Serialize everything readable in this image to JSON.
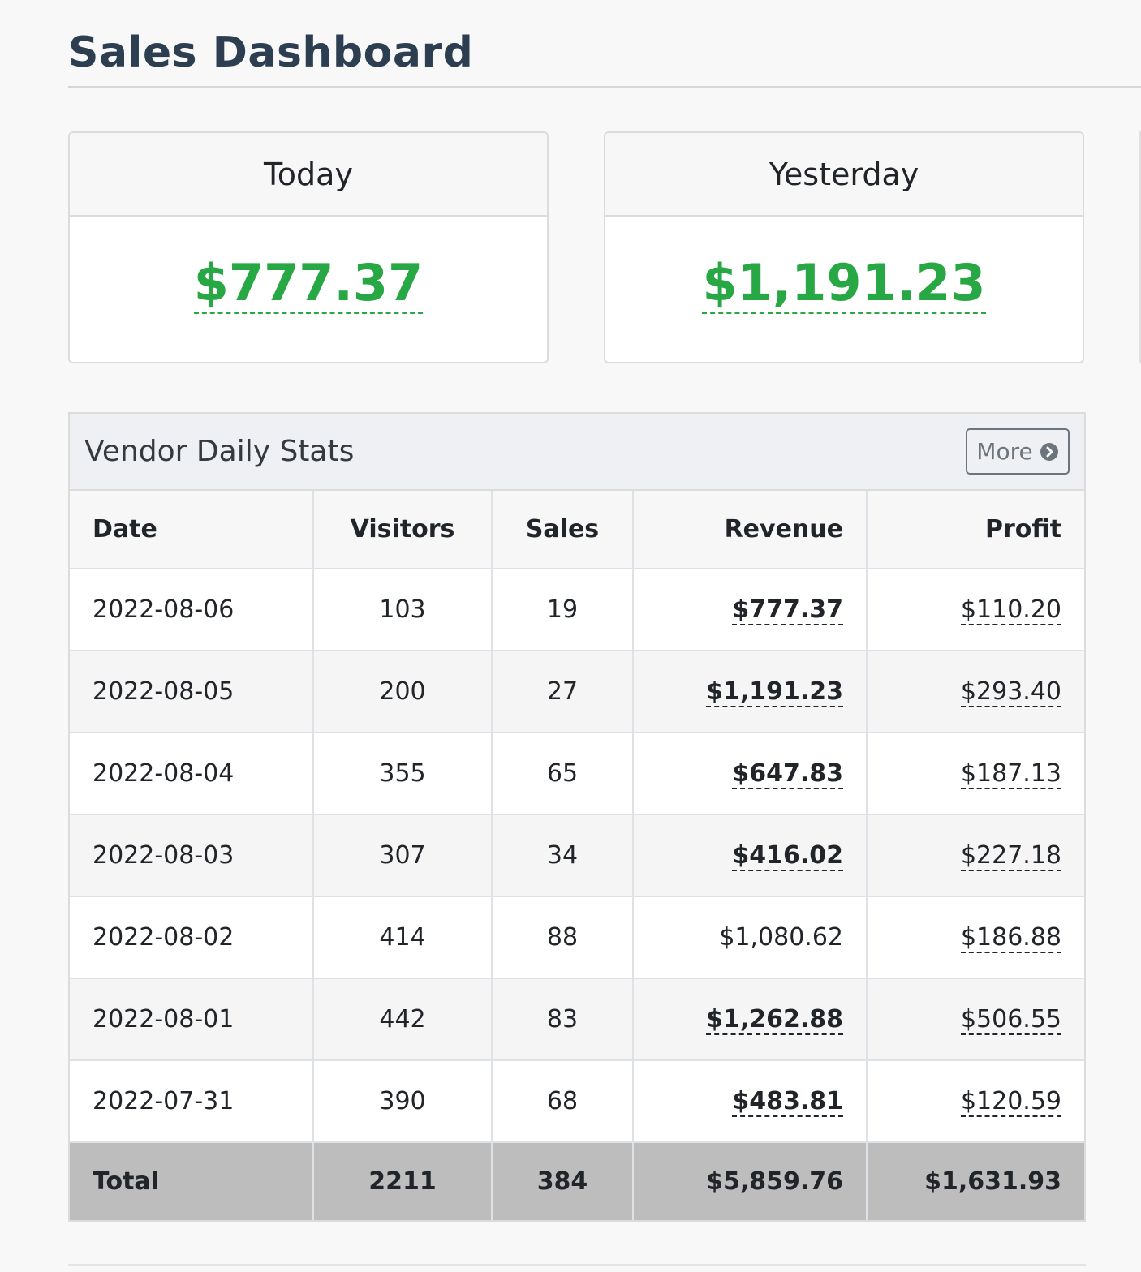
{
  "page": {
    "title": "Sales Dashboard"
  },
  "cards": {
    "today": {
      "label": "Today",
      "amount": "$777.37"
    },
    "yesterday": {
      "label": "Yesterday",
      "amount": "$1,191.23"
    }
  },
  "vendor_stats": {
    "title": "Vendor Daily Stats",
    "more_label": "More",
    "more_icon": "chevron-circle-right-icon",
    "columns": [
      "Date",
      "Visitors",
      "Sales",
      "Revenue",
      "Profit"
    ],
    "rows": [
      {
        "date": "2022-08-06",
        "visitors": "103",
        "sales": "19",
        "revenue": "$777.37",
        "revenue_emphasis": true,
        "profit": "$110.20"
      },
      {
        "date": "2022-08-05",
        "visitors": "200",
        "sales": "27",
        "revenue": "$1,191.23",
        "revenue_emphasis": true,
        "profit": "$293.40"
      },
      {
        "date": "2022-08-04",
        "visitors": "355",
        "sales": "65",
        "revenue": "$647.83",
        "revenue_emphasis": true,
        "profit": "$187.13"
      },
      {
        "date": "2022-08-03",
        "visitors": "307",
        "sales": "34",
        "revenue": "$416.02",
        "revenue_emphasis": true,
        "profit": "$227.18"
      },
      {
        "date": "2022-08-02",
        "visitors": "414",
        "sales": "88",
        "revenue": "$1,080.62",
        "revenue_emphasis": false,
        "profit": "$186.88"
      },
      {
        "date": "2022-08-01",
        "visitors": "442",
        "sales": "83",
        "revenue": "$1,262.88",
        "revenue_emphasis": true,
        "profit": "$506.55"
      },
      {
        "date": "2022-07-31",
        "visitors": "390",
        "sales": "68",
        "revenue": "$483.81",
        "revenue_emphasis": true,
        "profit": "$120.59"
      }
    ],
    "totals": {
      "label": "Total",
      "visitors": "2211",
      "sales": "384",
      "revenue": "$5,859.76",
      "profit": "$1,631.93"
    }
  },
  "colors": {
    "positive_amount": "#28a745",
    "title": "#2c3e50",
    "total_row_bg": "#bdbdbd"
  }
}
